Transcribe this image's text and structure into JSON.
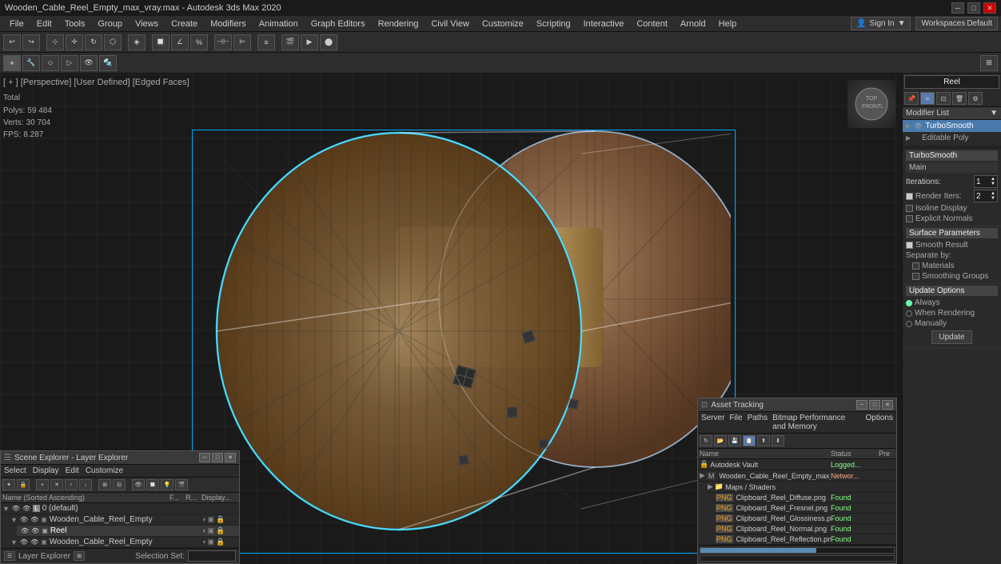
{
  "titlebar": {
    "title": "Wooden_Cable_Reel_Empty_max_vray.max - Autodesk 3ds Max 2020",
    "minimize": "─",
    "maximize": "□",
    "close": "✕"
  },
  "menubar": {
    "items": [
      "File",
      "Edit",
      "Tools",
      "Group",
      "Views",
      "Create",
      "Modifiers",
      "Animation",
      "Graph Editors",
      "Rendering",
      "Civil View",
      "Customize",
      "Scripting",
      "Interactive",
      "Content",
      "Arnold",
      "Help"
    ]
  },
  "toolbar": {
    "sign_in_label": "Sign In",
    "workspaces_label": "Workspaces",
    "workspace_name": "Default"
  },
  "viewport": {
    "label": "[ + ] [Perspective] [User Defined] [Edged Faces]",
    "stats_total": "Total",
    "stats_polys": "Polys:",
    "stats_polys_val": "59 484",
    "stats_verts": "Verts:",
    "stats_verts_val": "30 704",
    "fps_label": "FPS:",
    "fps_val": "8.287"
  },
  "modifier_panel": {
    "object_name": "Reel",
    "modifier_list_label": "Modifier List",
    "modifiers": [
      {
        "name": "TurboSmooth",
        "selected": true
      },
      {
        "name": "Editable Poly",
        "selected": false
      }
    ],
    "section_turbosmooth": "TurboSmooth",
    "section_main": "Main",
    "iterations_label": "Iterations:",
    "iterations_value": "1",
    "render_iters_label": "Render Iters:",
    "render_iters_value": "2",
    "isoline_display_label": "Isoline Display",
    "explicit_normals_label": "Explicit Normals",
    "surface_params_label": "Surface Parameters",
    "smooth_result_label": "Smooth Result",
    "separate_by_label": "Separate by:",
    "materials_label": "Materials",
    "smoothing_groups_label": "Smoothing Groups",
    "update_options_label": "Update Options",
    "always_label": "Always",
    "when_rendering_label": "When Rendering",
    "manually_label": "Manually",
    "update_btn": "Update",
    "icons": [
      "pin",
      "modifier",
      "param",
      "delete",
      "settings"
    ]
  },
  "scene_explorer": {
    "title": "Scene Explorer - Layer Explorer",
    "menus": [
      "Select",
      "Display",
      "Edit",
      "Customize"
    ],
    "columns": {
      "name": "Name (Sorted Ascending)",
      "f": "F...",
      "r": "R...",
      "display": "Display..."
    },
    "rows": [
      {
        "indent": 0,
        "type": "layer",
        "name": "0 (default)",
        "icons": [
          "eye",
          "eye",
          "sun"
        ]
      },
      {
        "indent": 1,
        "type": "object",
        "name": "Wooden_Cable_Reel_Empty",
        "icons": [
          "eye",
          "obj",
          "cam",
          "light",
          "render"
        ]
      },
      {
        "indent": 2,
        "type": "object",
        "name": "Reel",
        "icons": [
          "eye",
          "obj",
          "cam",
          "light",
          "render"
        ]
      },
      {
        "indent": 1,
        "type": "object",
        "name": "Wooden_Cable_Reel_Empty",
        "icons": [
          "eye",
          "obj",
          "cam",
          "light",
          "render"
        ]
      }
    ],
    "footer_label": "Layer Explorer",
    "selection_set_label": "Selection Set:"
  },
  "asset_tracking": {
    "title": "Asset Tracking",
    "menus": [
      "Server",
      "File",
      "Paths",
      "Bitmap Performance and Memory",
      "Options"
    ],
    "columns": {
      "name": "Name",
      "status": "Status",
      "pre": "Pre"
    },
    "rows": [
      {
        "indent": 0,
        "type": "vault",
        "name": "Autodesk Vault",
        "status": "Logged...",
        "pre": ""
      },
      {
        "indent": 0,
        "type": "max",
        "name": "Wooden_Cable_Reel_Empty_max_vray.max",
        "status": "Networ...",
        "pre": ""
      },
      {
        "indent": 1,
        "type": "folder",
        "name": "Maps / Shaders",
        "status": "",
        "pre": ""
      },
      {
        "indent": 2,
        "type": "png",
        "name": "Clipboard_Reel_Diffuse.png",
        "status": "Found",
        "pre": ""
      },
      {
        "indent": 2,
        "type": "png",
        "name": "Clipboard_Reel_Fresnel.png",
        "status": "Found",
        "pre": ""
      },
      {
        "indent": 2,
        "type": "png",
        "name": "Clipboard_Reel_Glossiness.png",
        "status": "Found",
        "pre": ""
      },
      {
        "indent": 2,
        "type": "png",
        "name": "Clipboard_Reel_Normal.png",
        "status": "Found",
        "pre": ""
      },
      {
        "indent": 2,
        "type": "png",
        "name": "Clipboard_Reel_Reflection.png",
        "status": "Found",
        "pre": ""
      }
    ]
  }
}
